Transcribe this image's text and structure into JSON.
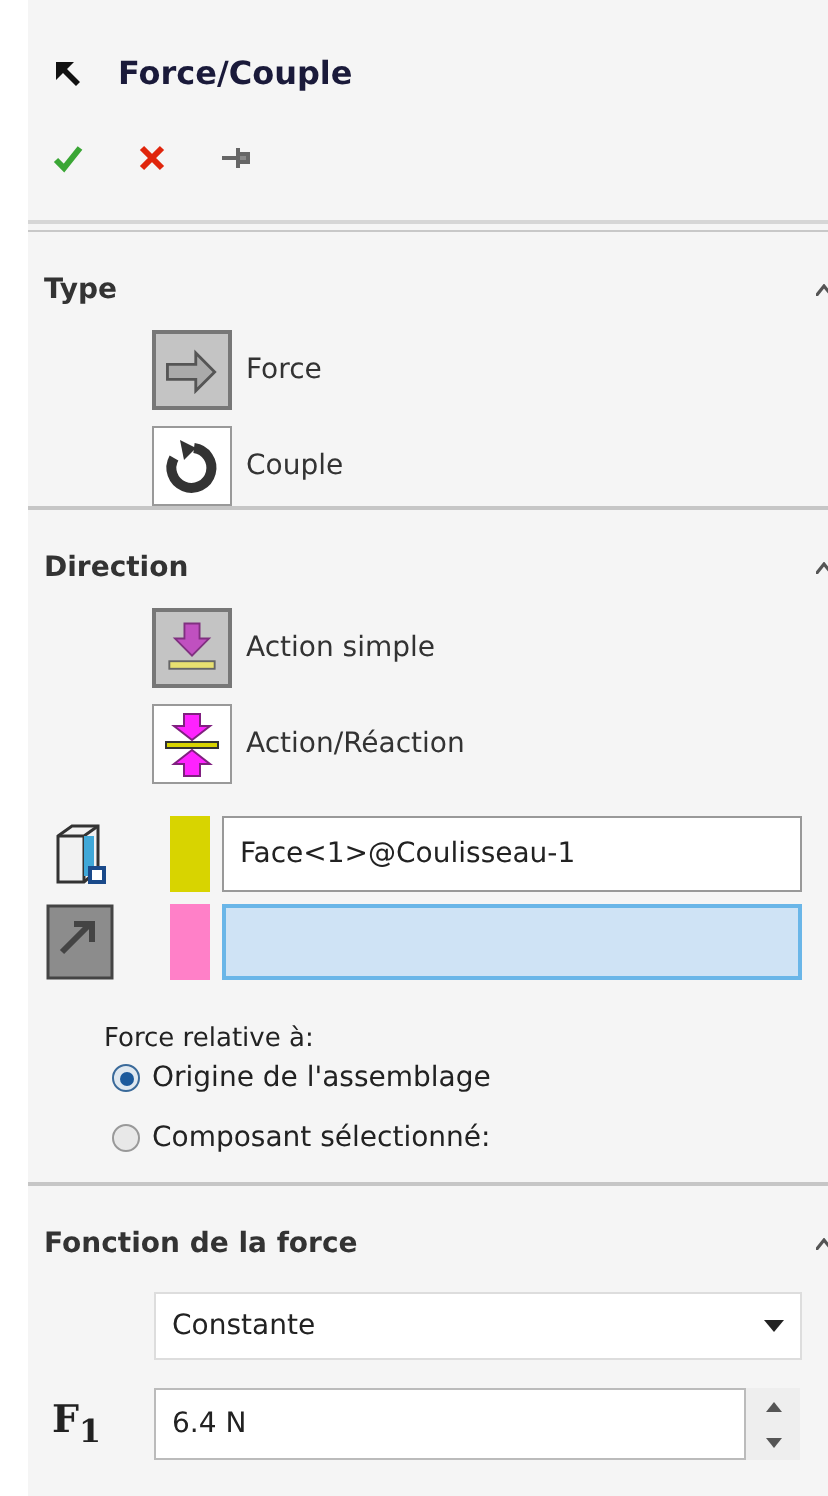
{
  "panel": {
    "title": "Force/Couple"
  },
  "toolbar": [
    {
      "kind": "ok"
    },
    {
      "kind": "cancel"
    },
    {
      "kind": "pin"
    }
  ],
  "sections": [
    {
      "title": "Type",
      "expanded": true,
      "options": [
        {
          "kind": "force",
          "label": "Force",
          "selected": true
        },
        {
          "kind": "couple",
          "label": "Couple",
          "selected": false
        }
      ]
    },
    {
      "title": "Direction",
      "expanded": true,
      "options": [
        {
          "kind": "single",
          "label": "Action simple",
          "selected": true
        },
        {
          "kind": "pair",
          "label": "Action/Réaction",
          "selected": false
        }
      ],
      "selections": [
        {
          "kind": "face",
          "color": "#d8d400",
          "value": "Face<1>@Coulisseau-1",
          "focused": false
        },
        {
          "kind": "direction",
          "color": "#ff80c8",
          "focused": true
        }
      ],
      "relative_label": "Force relative à:",
      "relative_options": [
        {
          "label": "Origine de l'assemblage",
          "selected": true
        },
        {
          "label": "Composant sélectionné:",
          "selected": false
        }
      ]
    },
    {
      "title": "Fonction de la force",
      "expanded": true,
      "function": "Constante",
      "symbol": "F$_{1}$",
      "value": "6.4 N"
    }
  ]
}
